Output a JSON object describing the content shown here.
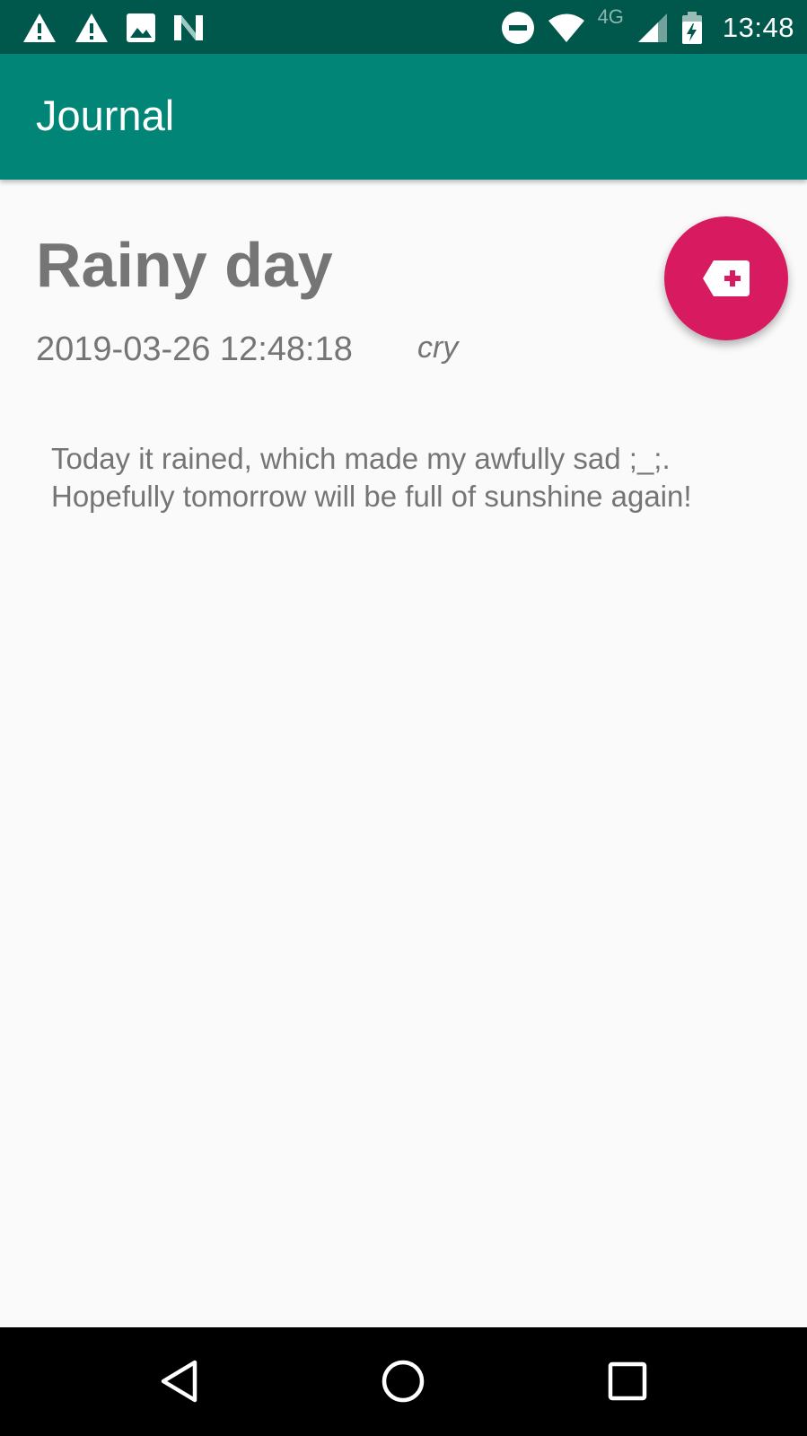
{
  "status_bar": {
    "time": "13:48",
    "network_label": "4G",
    "left_icons": [
      "warning-icon",
      "warning-icon",
      "image-icon",
      "n-icon"
    ],
    "right_icons": [
      "do-not-disturb-icon",
      "wifi-icon",
      "cellular-signal-icon",
      "battery-charging-icon"
    ]
  },
  "app_bar": {
    "title": "Journal"
  },
  "entry": {
    "title": "Rainy day",
    "date": "2019-03-26 12:48:18",
    "mood": "cry",
    "body": "Today it rained, which made my awfully sad ;_;. Hopefully tomorrow will be full of sunshine again!"
  },
  "fab": {
    "icon": "tag-add-icon"
  },
  "nav_bar": {
    "buttons": [
      "back-icon",
      "home-icon",
      "recents-icon"
    ]
  },
  "colors": {
    "status_bar": "#00574b",
    "app_bar": "#008577",
    "accent": "#d81b60",
    "text_secondary": "#757575",
    "background": "#fafafa"
  }
}
